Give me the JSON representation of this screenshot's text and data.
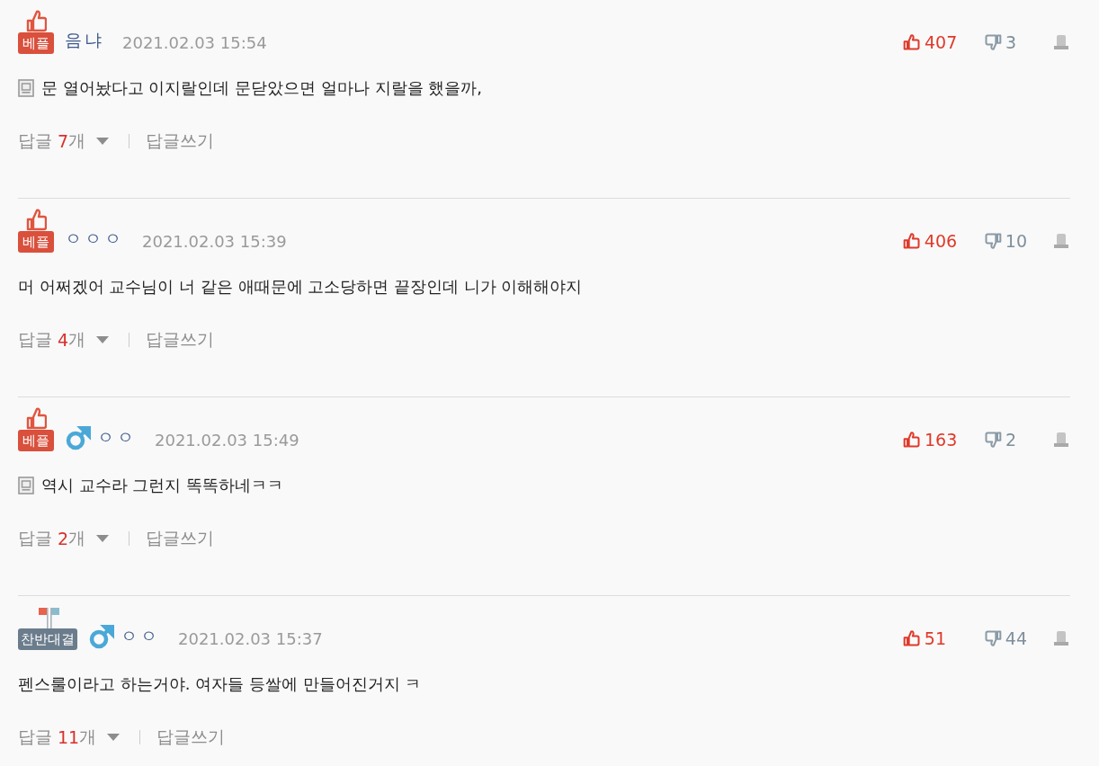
{
  "comments": [
    {
      "badge": {
        "kind": "best",
        "label": "베플"
      },
      "male": false,
      "author": "음냐",
      "date": "2021.02.03 15:54",
      "memo": true,
      "text": "문 열어놨다고 이지랄인데 문닫았으면 얼마나 지랄을 했을까,",
      "likes": "407",
      "dislikes": "3",
      "replies": {
        "label": "답글",
        "count": "7",
        "unit": "개"
      },
      "write_reply": "답글쓰기"
    },
    {
      "badge": {
        "kind": "best",
        "label": "베플"
      },
      "male": false,
      "author": "ㅇㅇㅇ",
      "date": "2021.02.03 15:39",
      "memo": false,
      "text": "머 어쩌겠어 교수님이 너 같은 애때문에 고소당하면 끝장인데 니가 이해해야지",
      "likes": "406",
      "dislikes": "10",
      "replies": {
        "label": "답글",
        "count": "4",
        "unit": "개"
      },
      "write_reply": "답글쓰기"
    },
    {
      "badge": {
        "kind": "best",
        "label": "베플"
      },
      "male": true,
      "author": "ㅇㅇ",
      "date": "2021.02.03 15:49",
      "memo": true,
      "text": "역시 교수라 그런지 똑똑하네ㅋㅋ",
      "likes": "163",
      "dislikes": "2",
      "replies": {
        "label": "답글",
        "count": "2",
        "unit": "개"
      },
      "write_reply": "답글쓰기"
    },
    {
      "badge": {
        "kind": "debate",
        "label": "찬반대결"
      },
      "male": true,
      "author": "ㅇㅇ",
      "date": "2021.02.03 15:37",
      "memo": false,
      "text": "펜스룰이라고 하는거야. 여자들 등쌀에 만들어진거지 ㅋ",
      "likes": "51",
      "dislikes": "44",
      "replies": {
        "label": "답글",
        "count": "11",
        "unit": "개"
      },
      "write_reply": "답글쓰기"
    }
  ]
}
